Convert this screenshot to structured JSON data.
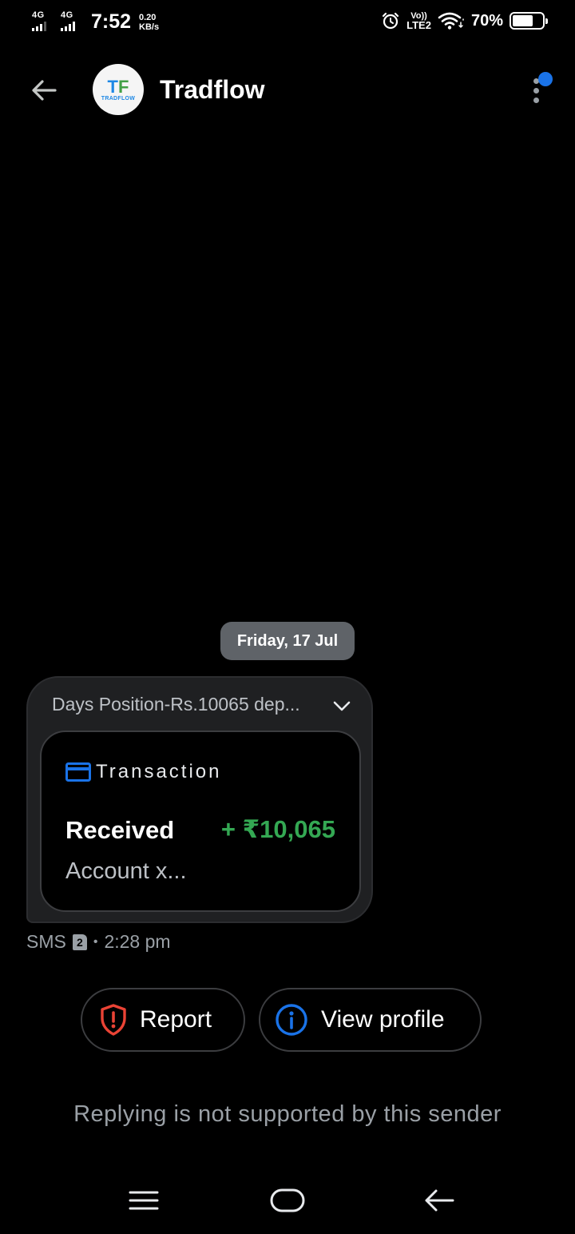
{
  "status_bar": {
    "net1": "4G",
    "net2": "4G",
    "time": "7:52",
    "speed_value": "0.20",
    "speed_unit": "KB/s",
    "volte_top": "Vo))",
    "volte_bottom": "LTE2",
    "battery": "70%",
    "battery_level": 0.7
  },
  "header": {
    "contact_name": "Tradflow",
    "avatar_text": "TRADFLOW",
    "avatar_mark": "T",
    "avatar_mark_accent": "F"
  },
  "thread": {
    "date_label": "Friday, 17 Jul",
    "message": {
      "summary": "Days Position-Rs.10065 dep...",
      "card": {
        "title": "Transaction",
        "status": "Received",
        "amount": "+ ₹10,065",
        "account": "Account x..."
      },
      "meta": {
        "channel": "SMS",
        "sim": "2",
        "separator": "•",
        "time": "2:28 pm"
      }
    }
  },
  "actions": {
    "report_label": "Report",
    "profile_label": "View profile"
  },
  "reply_note": "Replying is not supported by this sender",
  "colors": {
    "background": "#000000",
    "bubble": "#1f2022",
    "amount_green": "#34a853",
    "accent_blue": "#1a73e8",
    "report_red": "#ea4335",
    "date_chip": "#5f6368"
  }
}
